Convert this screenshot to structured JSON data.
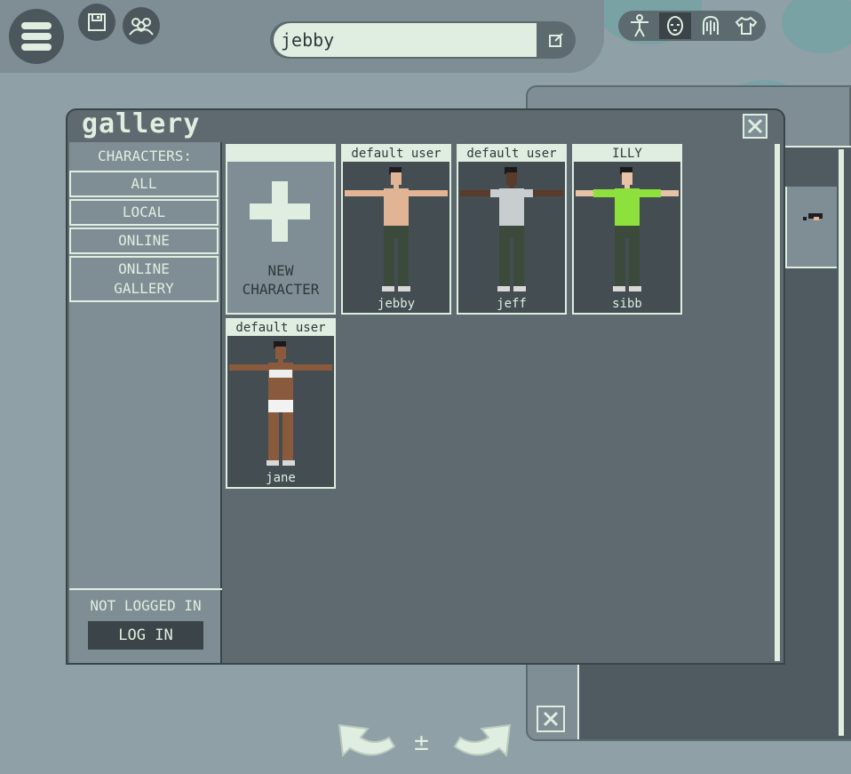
{
  "search": {
    "value": "jebby"
  },
  "toolbar": {
    "icons": [
      "body-icon",
      "face-icon",
      "hair-icon",
      "shirt-icon"
    ]
  },
  "gallery": {
    "title": "gallery",
    "sidebar": {
      "header": "CHARACTERS:",
      "items": [
        "ALL",
        "LOCAL",
        "ONLINE",
        "ONLINE\nGALLERY"
      ],
      "status": "NOT LOGGED IN",
      "login_label": "LOG IN"
    },
    "new_character": {
      "line1": "NEW",
      "line2": "CHARACTER"
    },
    "cards": [
      {
        "label": "default user",
        "name": "jebby",
        "shirt": "none",
        "skin": "#e0b494",
        "hair": "#1e1e22",
        "top": "#e0b494",
        "pants": "#3c4a3c"
      },
      {
        "label": "default user",
        "name": "jeff",
        "shirt": "tee",
        "skin": "#5a3a28",
        "hair": "#1a1a1a",
        "top": "#c8cdd0",
        "pants": "#3c4a3c"
      },
      {
        "label": "ILLY",
        "name": "sibb",
        "shirt": "sweater",
        "skin": "#e6c2a6",
        "hair": "#1a1a1a",
        "top": "#8ee03c",
        "pants": "#3c4a3c"
      },
      {
        "label": "default user",
        "name": "jane",
        "shirt": "bra",
        "skin": "#8a5a3c",
        "hair": "#1a1a1a",
        "top": "#eeeeee",
        "pants": "#f2f2f2"
      }
    ]
  },
  "bottom": {
    "middle_symbol": "±"
  }
}
